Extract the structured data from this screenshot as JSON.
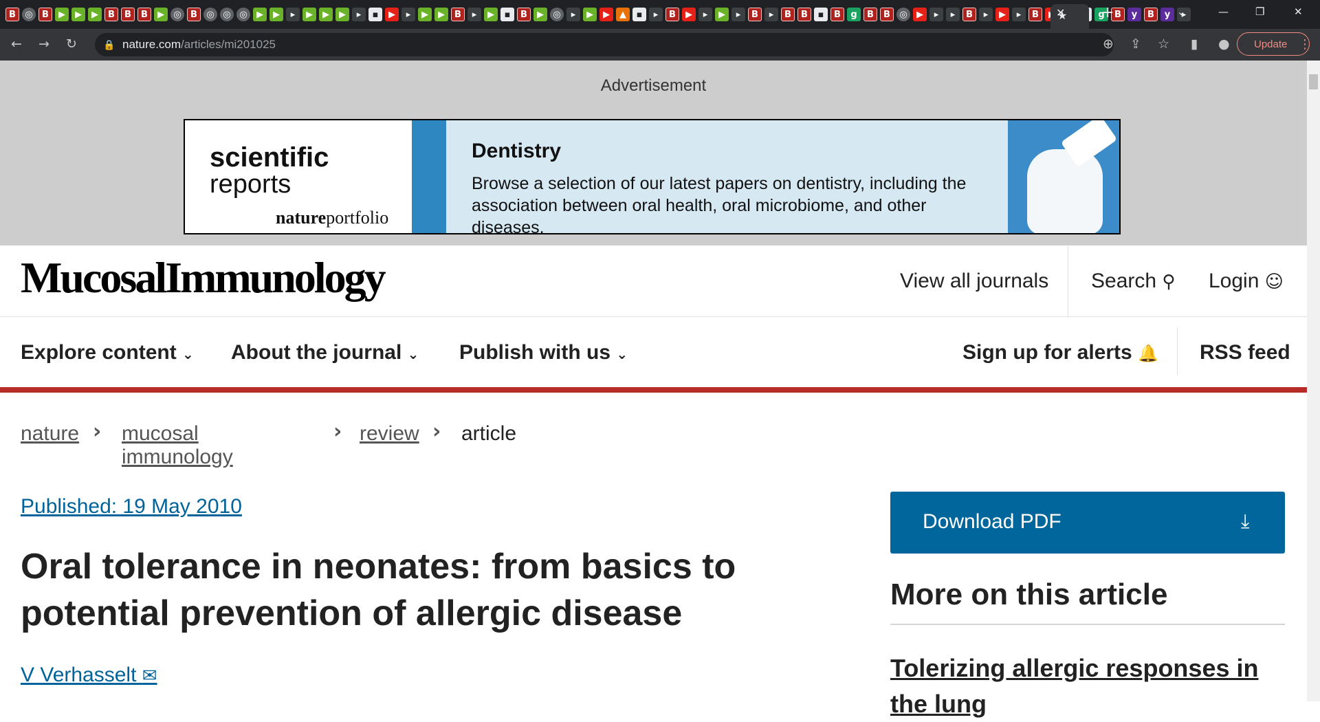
{
  "browser": {
    "url_host": "nature.com",
    "url_path": "/articles/mi201025",
    "update_label": "Update"
  },
  "tabs": {
    "favicons": [
      "b",
      "c",
      "b",
      "d",
      "d",
      "d",
      "b",
      "b",
      "b",
      "d",
      "c",
      "b",
      "c",
      "c",
      "c",
      "d",
      "d",
      "p",
      "d",
      "d",
      "d",
      "p",
      "n",
      "r",
      "p",
      "d",
      "d",
      "b",
      "p",
      "d",
      "n",
      "b",
      "d",
      "c",
      "p",
      "d",
      "r",
      "o",
      "n",
      "p",
      "b",
      "r",
      "p",
      "d",
      "p",
      "b",
      "p",
      "b",
      "b",
      "n",
      "b",
      "g",
      "b",
      "b",
      "c",
      "r",
      "p",
      "p",
      "b",
      "p",
      "r",
      "p",
      "b",
      "r",
      "y",
      "n",
      "g",
      "b",
      "y",
      "b",
      "y",
      "p"
    ],
    "new_tab_label": "+"
  },
  "ad": {
    "label": "Advertisement",
    "brand_line1": "scientific",
    "brand_line2": "reports",
    "brand_bold": "nature",
    "brand_rest": "portfolio",
    "heading": "Dentistry",
    "body": "Browse a selection of our latest papers on dentistry, including the association between oral health, oral microbiome, and other diseases."
  },
  "header": {
    "logo": "MucosalImmunology",
    "view_all_journals": "View all journals",
    "search": "Search",
    "login": "Login"
  },
  "nav": {
    "explore": "Explore content",
    "about": "About the journal",
    "publish": "Publish with us",
    "alerts": "Sign up for alerts",
    "rss": "RSS feed"
  },
  "breadcrumb": [
    "nature",
    "mucosal immunology",
    "review",
    "article"
  ],
  "article": {
    "published": "Published: 19 May 2010",
    "title": "Oral tolerance in neonates: from basics to potential prevention of allergic disease",
    "author": "V Verhasselt"
  },
  "sidebar": {
    "download_pdf": "Download PDF",
    "more_heading": "More on this article",
    "related_title": "Tolerizing allergic responses in the lung"
  }
}
